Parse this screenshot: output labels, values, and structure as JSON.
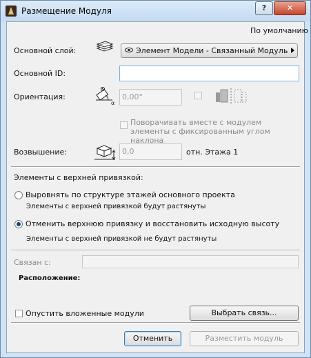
{
  "window": {
    "title": "Размещение Модуля",
    "help_label": "?",
    "close_label": "✕"
  },
  "default_link": "По умолчанию",
  "layer": {
    "label": "Основной слой:",
    "value": "Элемент Модели - Связанный Модуль",
    "icon": "layers-icon"
  },
  "master_id": {
    "label": "Основной ID:",
    "value": ""
  },
  "orientation": {
    "label": "Ориентация:",
    "value": "0,00°",
    "icon": "rotation-angle-icon"
  },
  "rotate_with_module": {
    "label": "Поворачивать вместе с модулем элементы с фиксированным углом наклона",
    "checked": false
  },
  "elevation": {
    "label": "Возвышение:",
    "value": "0,0",
    "reference": "отн. Этажа 1",
    "icon": "elevation-icon"
  },
  "top_linked": {
    "heading": "Элементы с верхней привязкой:",
    "options": [
      {
        "label": "Выровнять по структуре этажей основного проекта",
        "hint": "Элементы с верхней привязкой будут растянуты",
        "selected": false
      },
      {
        "label": "Отменить верхнюю привязку и восстановить исходную высоту",
        "hint": "Элементы с верхней привязкой не будут растянуты",
        "selected": true
      }
    ]
  },
  "linked_with": {
    "label": "Связан с:",
    "value": ""
  },
  "location": {
    "label": "Расположение:"
  },
  "skip_nested": {
    "label": "Опустить вложенные модули",
    "checked": false
  },
  "buttons": {
    "choose_link": "Выбрать связь...",
    "cancel": "Отменить",
    "place": "Разместить модуль"
  }
}
